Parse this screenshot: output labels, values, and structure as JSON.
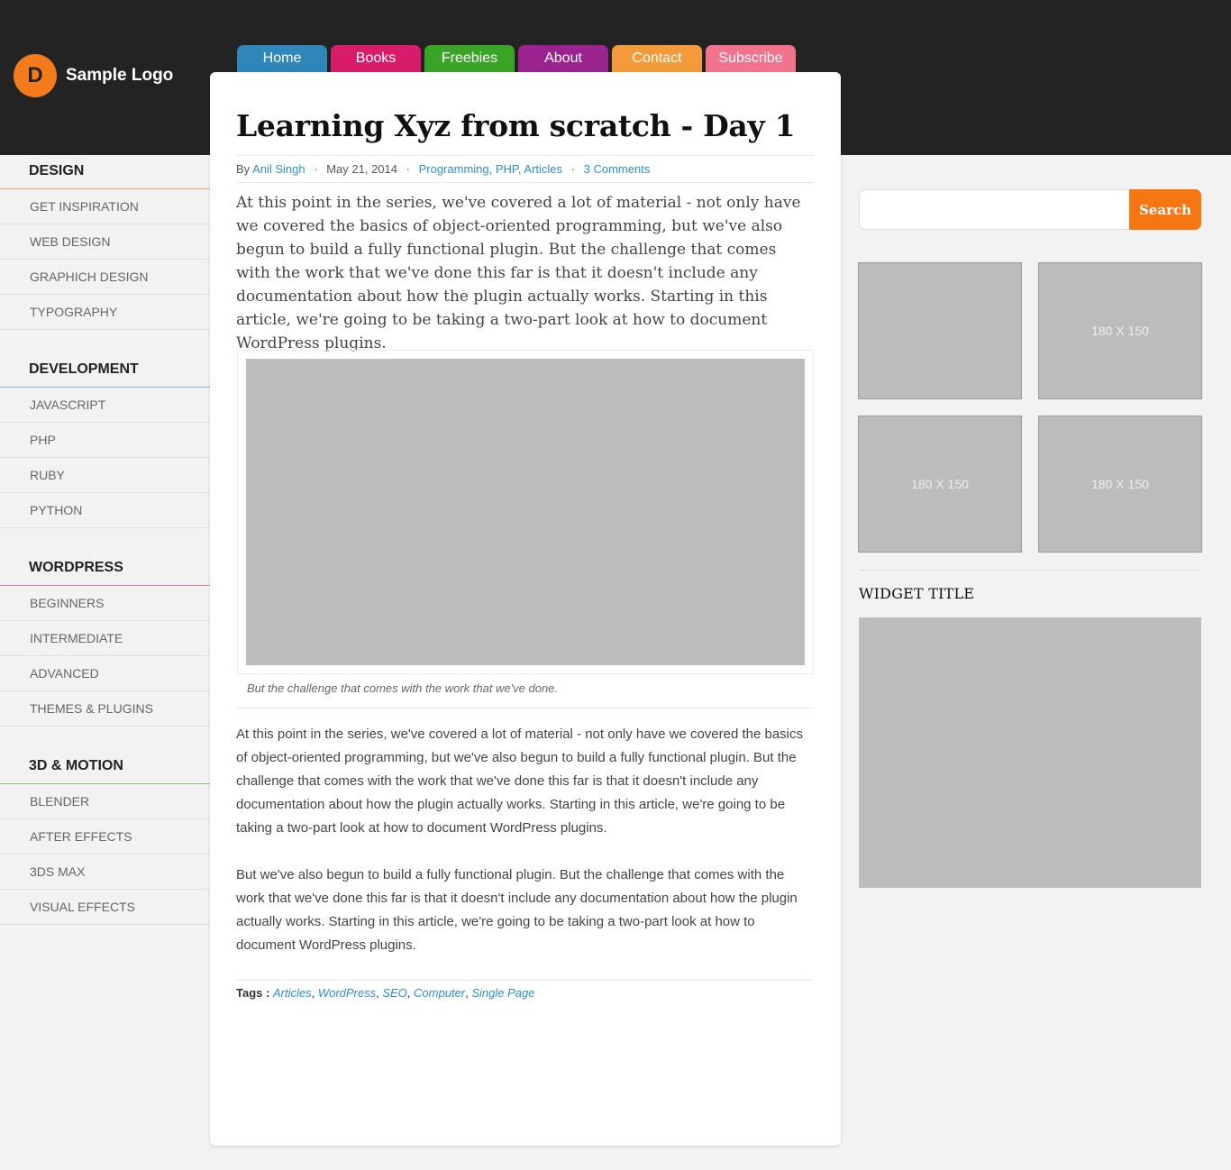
{
  "logo": {
    "mark": "D",
    "text": "Sample Logo"
  },
  "nav": [
    {
      "label": "Home",
      "color": "#2e86b9"
    },
    {
      "label": "Books",
      "color": "#d91b6b"
    },
    {
      "label": "Freebies",
      "color": "#3aa427"
    },
    {
      "label": "About",
      "color": "#9a238f"
    },
    {
      "label": "Contact",
      "color": "#f39a3a"
    },
    {
      "label": "Subscribe",
      "color": "#f2738d"
    }
  ],
  "sidebar": [
    {
      "heading": "DESIGN",
      "accent": "#f0a15a",
      "items": [
        "GET INSPIRATION",
        "WEB DESIGN",
        "GRAPHICH DESIGN",
        "TYPOGRAPHY"
      ]
    },
    {
      "heading": "DEVELOPMENT",
      "accent": "#7ab4df",
      "items": [
        "JAVASCRIPT",
        "PHP",
        "RUBY",
        "PYTHON"
      ]
    },
    {
      "heading": "WORDPRESS",
      "accent": "#e77aa9",
      "items": [
        "BEGINNERS",
        "INTERMEDIATE",
        "ADVANCED",
        "THEMES & PLUGINS"
      ]
    },
    {
      "heading": "3D & MOTION",
      "accent": "#82c47c",
      "items": [
        "BLENDER",
        "AFTER EFFECTS",
        "3DS MAX",
        "VISUAL EFFECTS"
      ]
    }
  ],
  "article": {
    "title": "Learning Xyz from scratch - Day 1",
    "by": "By",
    "author": "Anil Singh",
    "date": "May 21, 2014",
    "categories": "Programming, PHP, Articles",
    "comments": "3 Comments",
    "lead": "At this point in the series, we've covered a lot of material - not only have we covered the basics of object-oriented programming, but we've also begun to build a fully functional plugin. But the challenge that comes with the work that we've done this far is that it doesn't include any documentation about how the plugin actually works. Starting in this article, we're going to be taking a two-part look at how to document WordPress plugins.",
    "caption": "But the challenge that comes with the work that we've done.",
    "paragraph1": "At this point in the series, we've covered a lot of material - not only have we covered the basics of object-oriented programming, but we've also begun to build a fully functional plugin. But the challenge that comes with the work that we've done this far is that it doesn't include any documentation about how the plugin actually works. Starting in this article, we're going to be taking a two-part look at how to document WordPress plugins.",
    "paragraph2": "But we've also begun to build a fully functional plugin. But the challenge that comes with the work that we've done this far is that it doesn't include any documentation about how the plugin actually works. Starting in this article, we're going to be taking a two-part look at how to document WordPress plugins.",
    "tags_label": "Tags :",
    "tags": [
      "Articles",
      "WordPress",
      "SEO",
      "Computer",
      "Single Page"
    ]
  },
  "search": {
    "button": "Search",
    "placeholder": ""
  },
  "ads": [
    "",
    "180 X 150",
    "180 X 150",
    "180 X 150"
  ],
  "widget": {
    "title": "WIDGET TITLE"
  }
}
